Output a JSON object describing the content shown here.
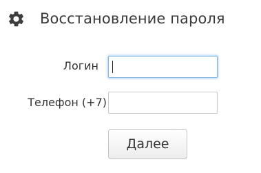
{
  "header": {
    "icon": "gear-icon",
    "title": "Восстановление пароля"
  },
  "form": {
    "login": {
      "label": "Логин",
      "value": "",
      "focused": true
    },
    "phone": {
      "label": "Телефон (+7)",
      "value": ""
    },
    "submit_label": "Далее"
  },
  "colors": {
    "focus_border": "#7fb7e4",
    "text": "#333333",
    "icon": "#3d3d3d"
  }
}
